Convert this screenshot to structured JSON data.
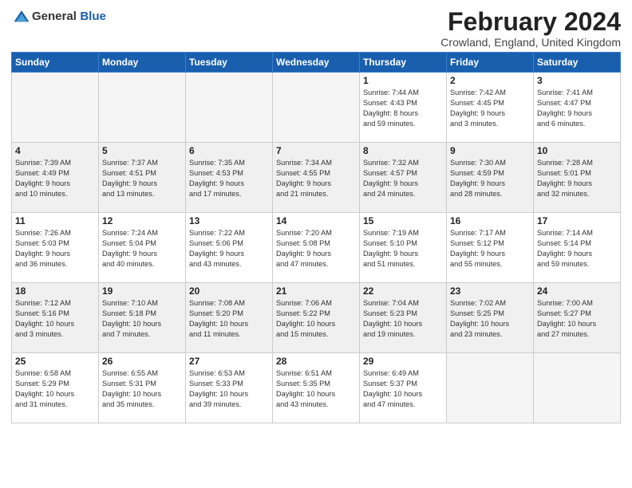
{
  "logo": {
    "text_general": "General",
    "text_blue": "Blue"
  },
  "title": {
    "month_year": "February 2024",
    "location": "Crowland, England, United Kingdom"
  },
  "days_of_week": [
    "Sunday",
    "Monday",
    "Tuesday",
    "Wednesday",
    "Thursday",
    "Friday",
    "Saturday"
  ],
  "weeks": [
    {
      "shade": false,
      "days": [
        {
          "num": "",
          "info": ""
        },
        {
          "num": "",
          "info": ""
        },
        {
          "num": "",
          "info": ""
        },
        {
          "num": "",
          "info": ""
        },
        {
          "num": "1",
          "info": "Sunrise: 7:44 AM\nSunset: 4:43 PM\nDaylight: 8 hours\nand 59 minutes."
        },
        {
          "num": "2",
          "info": "Sunrise: 7:42 AM\nSunset: 4:45 PM\nDaylight: 9 hours\nand 3 minutes."
        },
        {
          "num": "3",
          "info": "Sunrise: 7:41 AM\nSunset: 4:47 PM\nDaylight: 9 hours\nand 6 minutes."
        }
      ]
    },
    {
      "shade": true,
      "days": [
        {
          "num": "4",
          "info": "Sunrise: 7:39 AM\nSunset: 4:49 PM\nDaylight: 9 hours\nand 10 minutes."
        },
        {
          "num": "5",
          "info": "Sunrise: 7:37 AM\nSunset: 4:51 PM\nDaylight: 9 hours\nand 13 minutes."
        },
        {
          "num": "6",
          "info": "Sunrise: 7:35 AM\nSunset: 4:53 PM\nDaylight: 9 hours\nand 17 minutes."
        },
        {
          "num": "7",
          "info": "Sunrise: 7:34 AM\nSunset: 4:55 PM\nDaylight: 9 hours\nand 21 minutes."
        },
        {
          "num": "8",
          "info": "Sunrise: 7:32 AM\nSunset: 4:57 PM\nDaylight: 9 hours\nand 24 minutes."
        },
        {
          "num": "9",
          "info": "Sunrise: 7:30 AM\nSunset: 4:59 PM\nDaylight: 9 hours\nand 28 minutes."
        },
        {
          "num": "10",
          "info": "Sunrise: 7:28 AM\nSunset: 5:01 PM\nDaylight: 9 hours\nand 32 minutes."
        }
      ]
    },
    {
      "shade": false,
      "days": [
        {
          "num": "11",
          "info": "Sunrise: 7:26 AM\nSunset: 5:03 PM\nDaylight: 9 hours\nand 36 minutes."
        },
        {
          "num": "12",
          "info": "Sunrise: 7:24 AM\nSunset: 5:04 PM\nDaylight: 9 hours\nand 40 minutes."
        },
        {
          "num": "13",
          "info": "Sunrise: 7:22 AM\nSunset: 5:06 PM\nDaylight: 9 hours\nand 43 minutes."
        },
        {
          "num": "14",
          "info": "Sunrise: 7:20 AM\nSunset: 5:08 PM\nDaylight: 9 hours\nand 47 minutes."
        },
        {
          "num": "15",
          "info": "Sunrise: 7:19 AM\nSunset: 5:10 PM\nDaylight: 9 hours\nand 51 minutes."
        },
        {
          "num": "16",
          "info": "Sunrise: 7:17 AM\nSunset: 5:12 PM\nDaylight: 9 hours\nand 55 minutes."
        },
        {
          "num": "17",
          "info": "Sunrise: 7:14 AM\nSunset: 5:14 PM\nDaylight: 9 hours\nand 59 minutes."
        }
      ]
    },
    {
      "shade": true,
      "days": [
        {
          "num": "18",
          "info": "Sunrise: 7:12 AM\nSunset: 5:16 PM\nDaylight: 10 hours\nand 3 minutes."
        },
        {
          "num": "19",
          "info": "Sunrise: 7:10 AM\nSunset: 5:18 PM\nDaylight: 10 hours\nand 7 minutes."
        },
        {
          "num": "20",
          "info": "Sunrise: 7:08 AM\nSunset: 5:20 PM\nDaylight: 10 hours\nand 11 minutes."
        },
        {
          "num": "21",
          "info": "Sunrise: 7:06 AM\nSunset: 5:22 PM\nDaylight: 10 hours\nand 15 minutes."
        },
        {
          "num": "22",
          "info": "Sunrise: 7:04 AM\nSunset: 5:23 PM\nDaylight: 10 hours\nand 19 minutes."
        },
        {
          "num": "23",
          "info": "Sunrise: 7:02 AM\nSunset: 5:25 PM\nDaylight: 10 hours\nand 23 minutes."
        },
        {
          "num": "24",
          "info": "Sunrise: 7:00 AM\nSunset: 5:27 PM\nDaylight: 10 hours\nand 27 minutes."
        }
      ]
    },
    {
      "shade": false,
      "days": [
        {
          "num": "25",
          "info": "Sunrise: 6:58 AM\nSunset: 5:29 PM\nDaylight: 10 hours\nand 31 minutes."
        },
        {
          "num": "26",
          "info": "Sunrise: 6:55 AM\nSunset: 5:31 PM\nDaylight: 10 hours\nand 35 minutes."
        },
        {
          "num": "27",
          "info": "Sunrise: 6:53 AM\nSunset: 5:33 PM\nDaylight: 10 hours\nand 39 minutes."
        },
        {
          "num": "28",
          "info": "Sunrise: 6:51 AM\nSunset: 5:35 PM\nDaylight: 10 hours\nand 43 minutes."
        },
        {
          "num": "29",
          "info": "Sunrise: 6:49 AM\nSunset: 5:37 PM\nDaylight: 10 hours\nand 47 minutes."
        },
        {
          "num": "",
          "info": ""
        },
        {
          "num": "",
          "info": ""
        }
      ]
    }
  ]
}
